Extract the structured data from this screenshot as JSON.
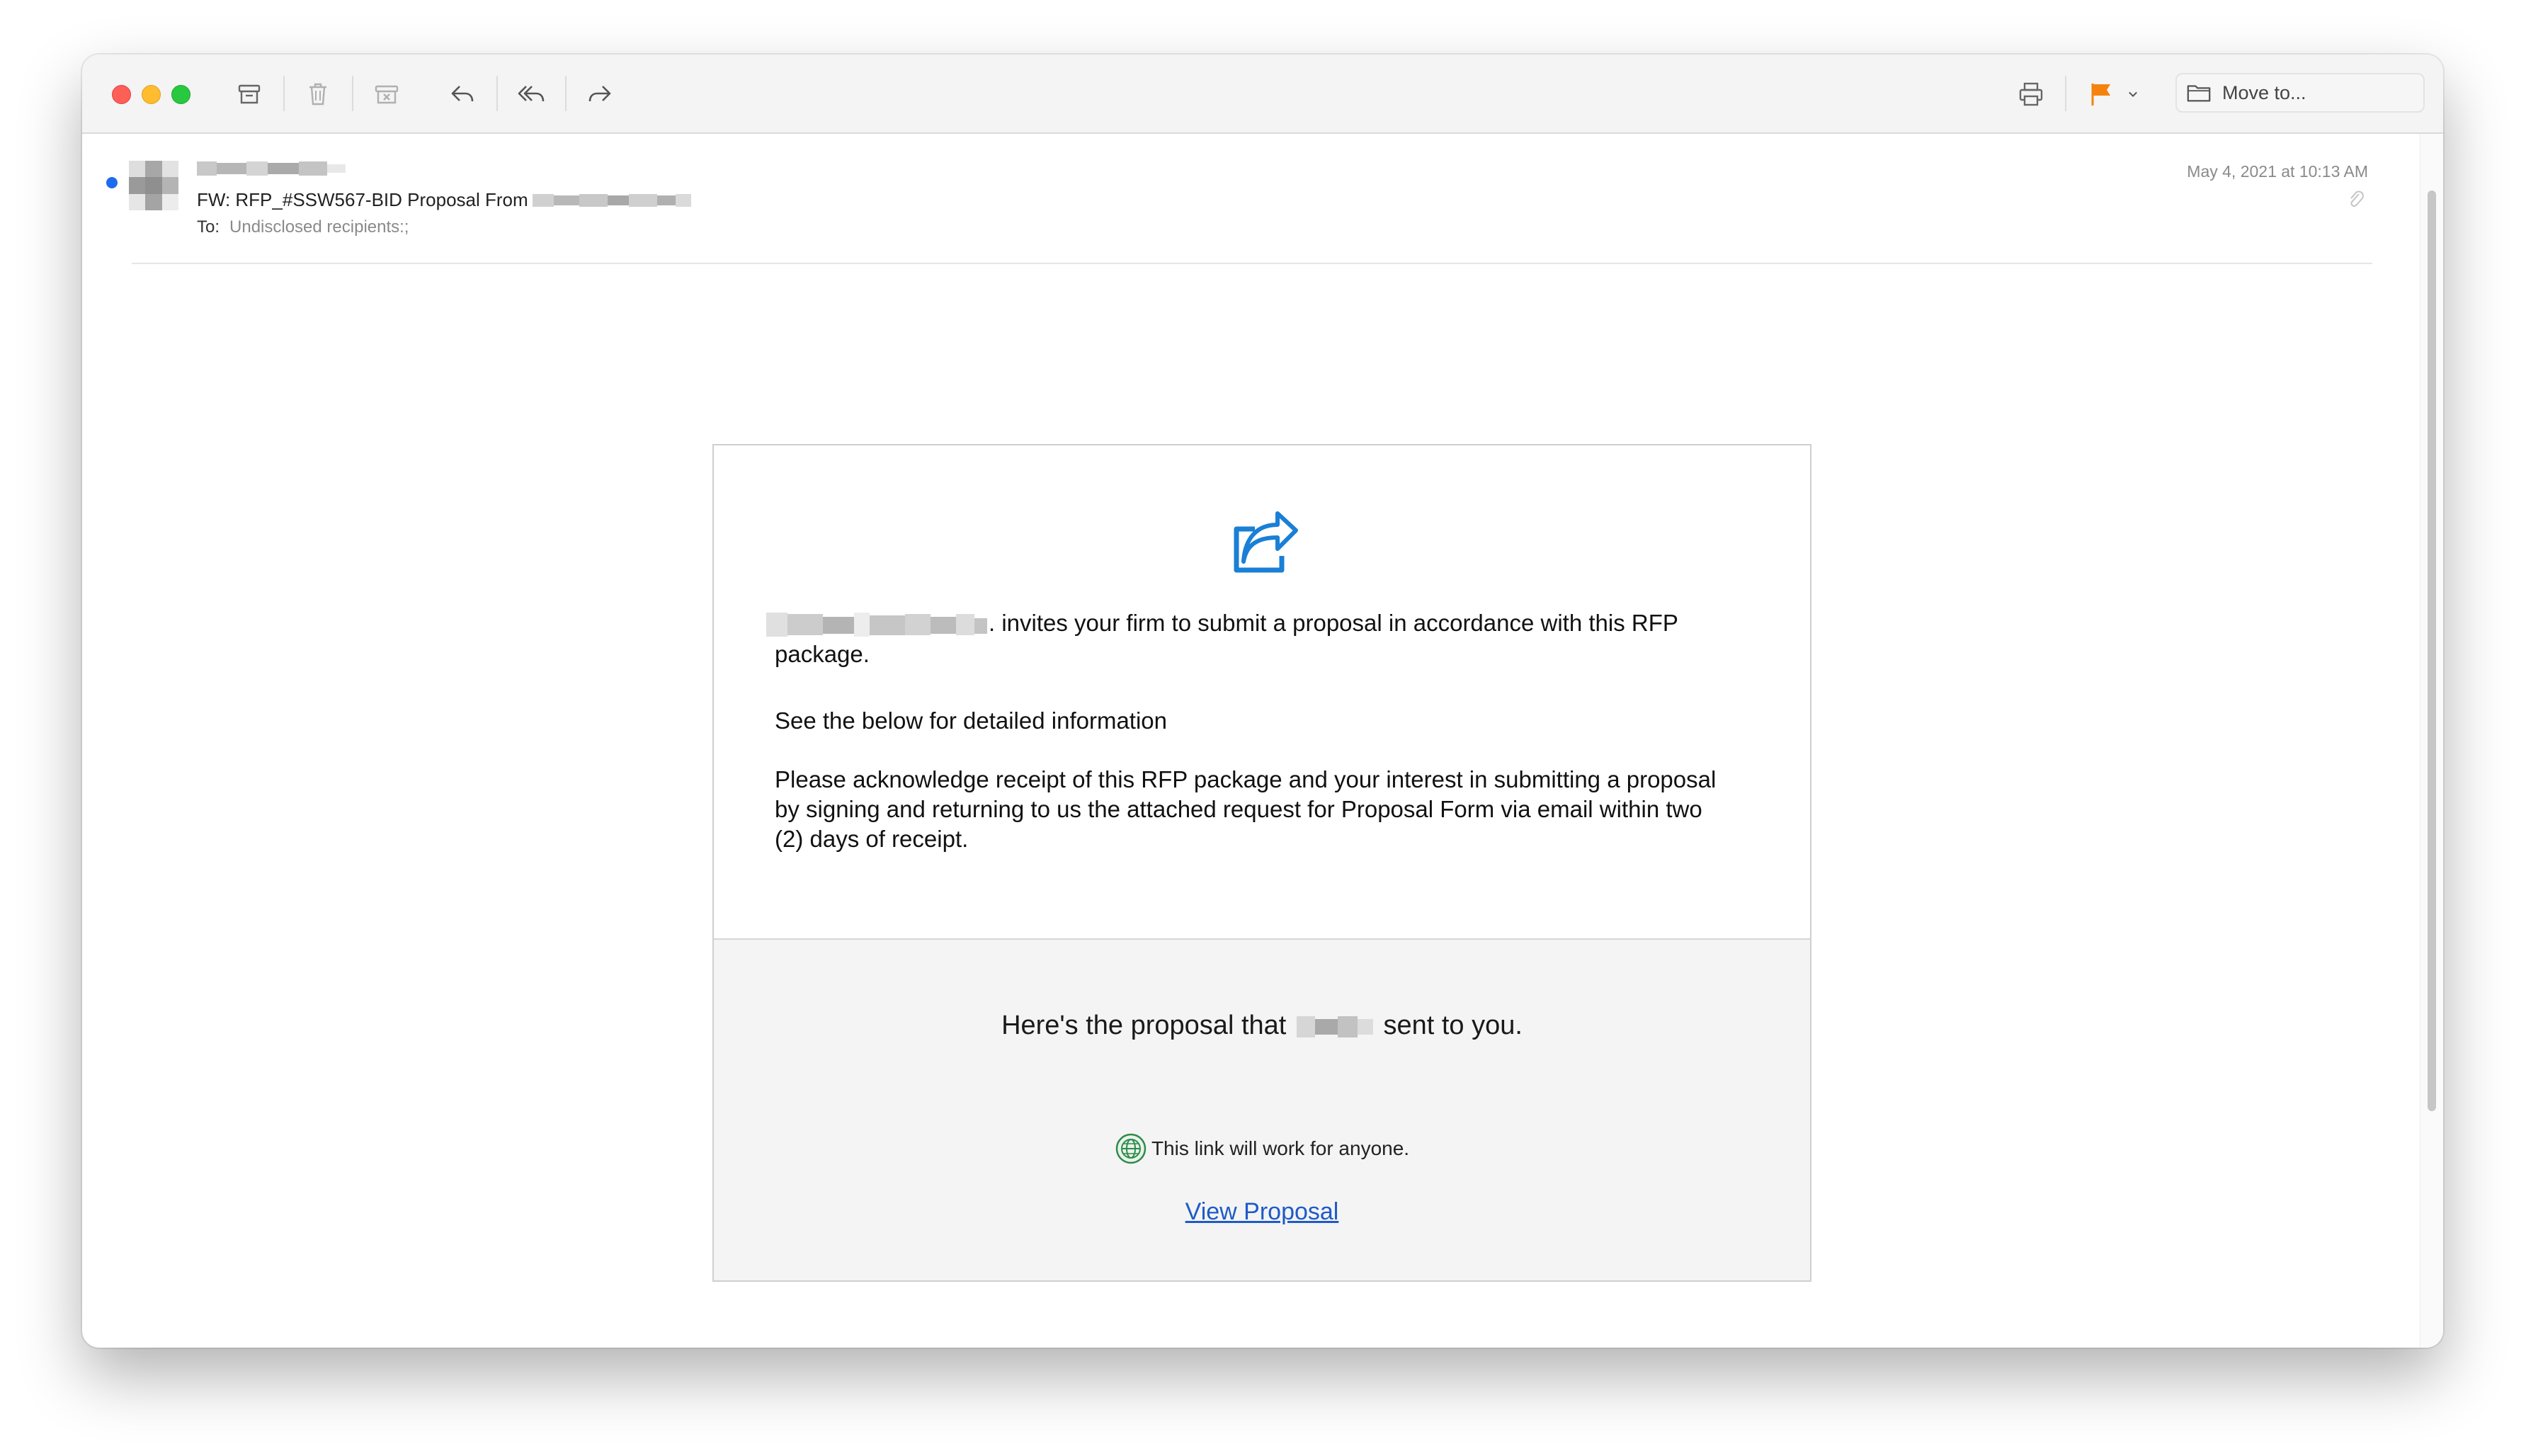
{
  "toolbar": {
    "buttons": [
      "archive-icon",
      "trash-icon",
      "junk-icon",
      "reply-icon",
      "reply-all-icon",
      "forward-icon",
      "print-icon",
      "flag-icon",
      "chevron-down-icon"
    ],
    "move_to_label": "Move to...",
    "flag_color": "#f5820d"
  },
  "message": {
    "subject": "FW: RFP_#SSW567-BID Proposal From",
    "to_label": "To:",
    "to_value": "Undisclosed recipients:;",
    "date": "May 4, 2021 at 10:13 AM",
    "unread_dot_color": "#1e6bf0"
  },
  "body": {
    "invite_text": ". invites your firm to submit a proposal in accordance with this RFP package.",
    "details_text": "See the below for detailed information",
    "acknowledge_text": "Please acknowledge receipt of this RFP package and your interest in submitting a proposal by signing and returning to us the attached request for Proposal Form via email within two (2) days of receipt.",
    "proposal_prefix": "Here's the proposal that",
    "proposal_suffix": "sent to you.",
    "anyone_text": "This link will work for anyone.",
    "view_link": "View Proposal",
    "link_color": "#1e5bc8",
    "icon_color": "#1a7fd6"
  }
}
